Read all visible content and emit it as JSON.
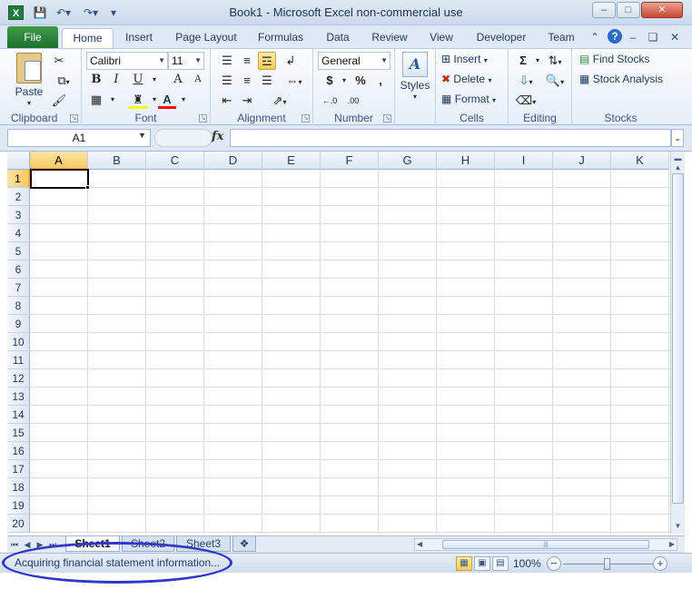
{
  "app": {
    "title": "Book1  -  Microsoft Excel non-commercial use",
    "icon_letter": "X"
  },
  "quick_access": {
    "save_icon": "save-icon",
    "undo_icon": "undo-icon",
    "redo_icon": "redo-icon",
    "customize_icon": "customize-qat-icon"
  },
  "window_controls": {
    "minimize": "–",
    "maximize": "□",
    "close": "✕"
  },
  "tabs": {
    "file": "File",
    "items": [
      "Home",
      "Insert",
      "Page Layout",
      "Formulas",
      "Data",
      "Review",
      "View",
      "Developer",
      "Team"
    ],
    "active": "Home"
  },
  "ribbon": {
    "clipboard": {
      "label": "Clipboard",
      "paste": "Paste"
    },
    "font": {
      "label": "Font",
      "name": "Calibri",
      "size": "11",
      "bold": "B",
      "italic": "I",
      "underline": "U",
      "grow": "A",
      "shrink": "A",
      "fill_color": "#ffff00",
      "font_color": "#ff0000"
    },
    "alignment": {
      "label": "Alignment"
    },
    "number": {
      "label": "Number",
      "format": "General",
      "currency": "$",
      "percent": "%",
      "comma": ",",
      "inc_decimal": "←.0",
      "dec_decimal": ".00"
    },
    "styles": {
      "label": "Styles"
    },
    "cells": {
      "label": "Cells",
      "insert": "Insert",
      "delete": "Delete",
      "format": "Format"
    },
    "editing": {
      "label": "Editing",
      "sum": "Σ"
    },
    "stocks": {
      "label": "Stocks",
      "find": "Find Stocks",
      "analysis": "Stock Analysis"
    }
  },
  "formula_bar": {
    "name_box": "A1",
    "fx": "fx",
    "value": ""
  },
  "grid": {
    "columns": [
      "A",
      "B",
      "C",
      "D",
      "E",
      "F",
      "G",
      "H",
      "I",
      "J",
      "K"
    ],
    "rows": [
      "1",
      "2",
      "3",
      "4",
      "5",
      "6",
      "7",
      "8",
      "9",
      "10",
      "11",
      "12",
      "13",
      "14",
      "15",
      "16",
      "17",
      "18",
      "19",
      "20"
    ],
    "active_cell": "A1"
  },
  "sheets": {
    "tabs": [
      "Sheet1",
      "Sheet2",
      "Sheet3"
    ],
    "active": "Sheet1"
  },
  "status": {
    "message": "Acquiring financial statement information...",
    "zoom": "100%"
  }
}
